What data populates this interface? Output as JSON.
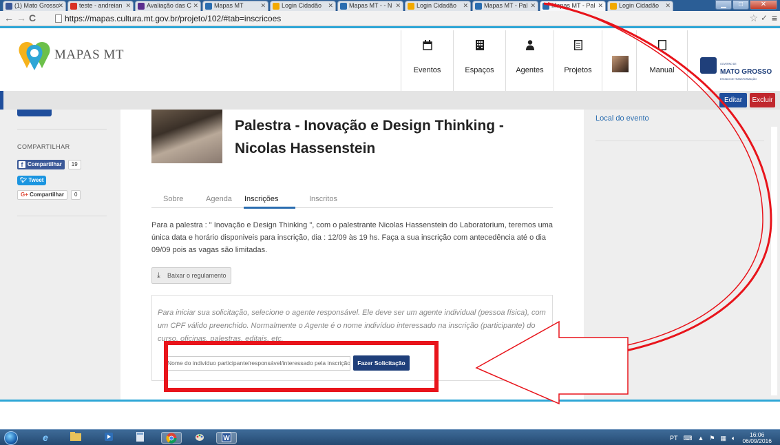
{
  "browser": {
    "tabs": [
      {
        "label": "(1) Mato Grosso",
        "favicon_color": "#3b5998"
      },
      {
        "label": "teste - andreian",
        "favicon_color": "#d93025"
      },
      {
        "label": "Avaliação das C",
        "favicon_color": "#5b2d8e"
      },
      {
        "label": "Mapas MT",
        "favicon_color": "#2a6db0"
      },
      {
        "label": "Login Cidadão",
        "favicon_color": "#f2a900"
      },
      {
        "label": "Mapas MT - - N",
        "favicon_color": "#2a6db0"
      },
      {
        "label": "Login Cidadão",
        "favicon_color": "#f2a900"
      },
      {
        "label": "Mapas MT - Pal",
        "favicon_color": "#2a6db0"
      },
      {
        "label": "Mapas MT - Pal",
        "favicon_color": "#2a6db0"
      },
      {
        "label": "Login Cidadão",
        "favicon_color": "#f2a900"
      }
    ],
    "url": "https://mapas.cultura.mt.gov.br/projeto/102/#tab=inscricoes"
  },
  "header": {
    "logo_text": "MAPAS MT",
    "nav": [
      {
        "label": "Eventos",
        "icon": "calendar-icon"
      },
      {
        "label": "Espaços",
        "icon": "building-icon"
      },
      {
        "label": "Agentes",
        "icon": "user-icon"
      },
      {
        "label": "Projetos",
        "icon": "document-icon"
      },
      {
        "label": "Manual",
        "icon": "manual-icon"
      }
    ],
    "gov_logo_text": "MATO GROSSO"
  },
  "editbar": {
    "edit_label": "Editar",
    "delete_label": "Excluir"
  },
  "left_sidebar": {
    "share_title": "COMPARTILHAR",
    "facebook_label": "Compartilhar",
    "facebook_count": "19",
    "twitter_label": "Tweet",
    "gplus_label": "Compartilhar",
    "gplus_count": "0"
  },
  "right_sidebar": {
    "local_link": "Local do evento"
  },
  "main": {
    "title": "Palestra - Inovação e Design Thinking - Nicolas Hassenstein",
    "tabs": [
      "Sobre",
      "Agenda",
      "Inscrições",
      "Inscritos"
    ],
    "active_tab": "Inscrições",
    "description": "Para a palestra : \" Inovação e Design Thinking \", com o palestrante Nicolas Hassenstein do Laboratorium, teremos uma única data e horário disponiveis para inscrição, dia : 12/09 às 19 hs. Faça a sua inscrição com antecedência até o dia 09/09 pois as vagas são limitadas.",
    "download_label": "Baixar o regulamento",
    "panel_text": "Para iniciar sua solicitação, selecione o agente responsável. Ele deve ser um agente individual (pessoa física), com um CPF válido preenchido. Normalmente o Agente é o nome indivíduo interessado na inscrição (participante) do curso, oficinas, palestras, editais, etc.",
    "agent_placeholder": "Nome do indivíduo participante/responsável/interessado pela inscrição",
    "request_label": "Fazer Solicitação"
  },
  "taskbar": {
    "lang": "PT",
    "time": "16:06",
    "date": "06/09/2016"
  },
  "colors": {
    "brand_blue": "#1f4e9c",
    "accent_cyan": "#2ea6d6",
    "annotation_red": "#e8141b",
    "delete_red": "#c0272d"
  }
}
